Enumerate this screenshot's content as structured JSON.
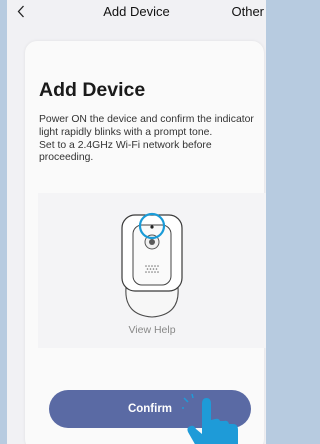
{
  "nav": {
    "back_icon": "chevron-left-icon",
    "title": "Add Device",
    "other_label": "Other"
  },
  "main": {
    "title": "Add Device",
    "instructions": [
      "Power ON the device and confirm the indicator light rapidly blinks with a prompt tone.",
      "Set to a 2.4GHz Wi-Fi network before proceeding."
    ],
    "illustration_icon": "camera-device-icon",
    "view_help_label": "View Help",
    "confirm_label": "Confirm"
  },
  "colors": {
    "accent": "#5a6aa4",
    "highlight_ring": "#1a9bd7",
    "cursor": "#1e9bd8",
    "background": "#b7cbe0"
  }
}
